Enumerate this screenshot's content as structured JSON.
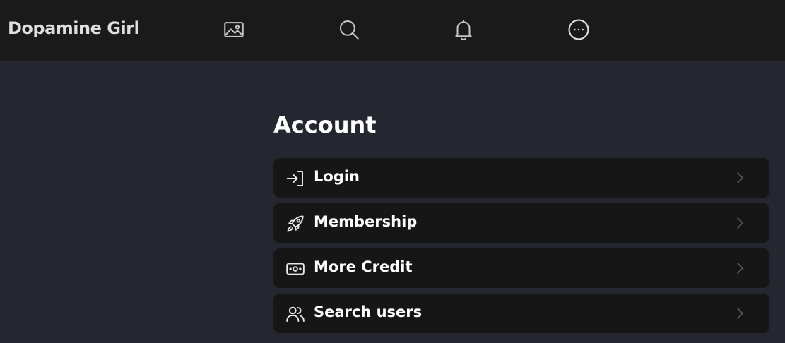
{
  "header": {
    "brand": "Dopamine Girl",
    "nav": [
      {
        "name": "gallery",
        "icon": "image-icon"
      },
      {
        "name": "search",
        "icon": "search-icon"
      },
      {
        "name": "notifications",
        "icon": "bell-icon"
      },
      {
        "name": "more",
        "icon": "more-circle-icon"
      }
    ]
  },
  "account": {
    "title": "Account",
    "items": [
      {
        "label": "Login",
        "icon": "login-icon"
      },
      {
        "label": "Membership",
        "icon": "rocket-icon"
      },
      {
        "label": "More Credit",
        "icon": "banknote-icon"
      },
      {
        "label": "Search users",
        "icon": "users-icon"
      }
    ]
  },
  "colors": {
    "background": "#242630",
    "topbar": "#1a1a1a",
    "card": "#161616",
    "icon": "#d0d0d0",
    "chevron": "#5a5a5a"
  }
}
